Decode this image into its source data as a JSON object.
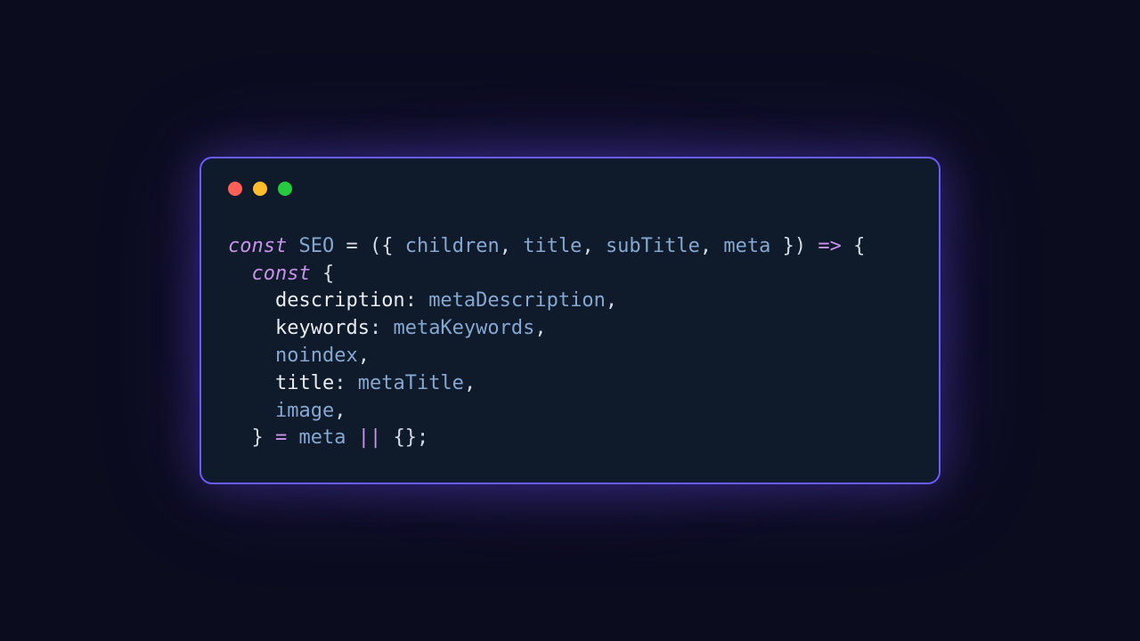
{
  "window": {
    "traffic": {
      "red": "#ff5f56",
      "yellow": "#ffbd2e",
      "green": "#27c93f"
    }
  },
  "code": {
    "tokens": {
      "l1_const": "const",
      "l1_fn": "SEO",
      "l1_eq": " = ",
      "l1_open": "({ ",
      "l1_p1": "children",
      "l1_c1": ", ",
      "l1_p2": "title",
      "l1_c2": ", ",
      "l1_p3": "subTitle",
      "l1_c3": ", ",
      "l1_p4": "meta",
      "l1_close": " })",
      "l1_arrow": " => ",
      "l1_brace": "{",
      "l2_indent": "  ",
      "l2_const": "const",
      "l2_brace": " {",
      "l3_indent": "    ",
      "l3_key": "description",
      "l3_colon": ": ",
      "l3_val": "metaDescription",
      "l3_comma": ",",
      "l4_indent": "    ",
      "l4_key": "keywords",
      "l4_colon": ": ",
      "l4_val": "metaKeywords",
      "l4_comma": ",",
      "l5_indent": "    ",
      "l5_key": "noindex",
      "l5_comma": ",",
      "l6_indent": "    ",
      "l6_key": "title",
      "l6_colon": ": ",
      "l6_val": "metaTitle",
      "l6_comma": ",",
      "l7_indent": "    ",
      "l7_key": "image",
      "l7_comma": ",",
      "l8_indent": "  ",
      "l8_close": "} ",
      "l8_eq": "= ",
      "l8_meta": "meta",
      "l8_or": " || ",
      "l8_empty": "{}",
      "l8_semi": ";"
    }
  }
}
